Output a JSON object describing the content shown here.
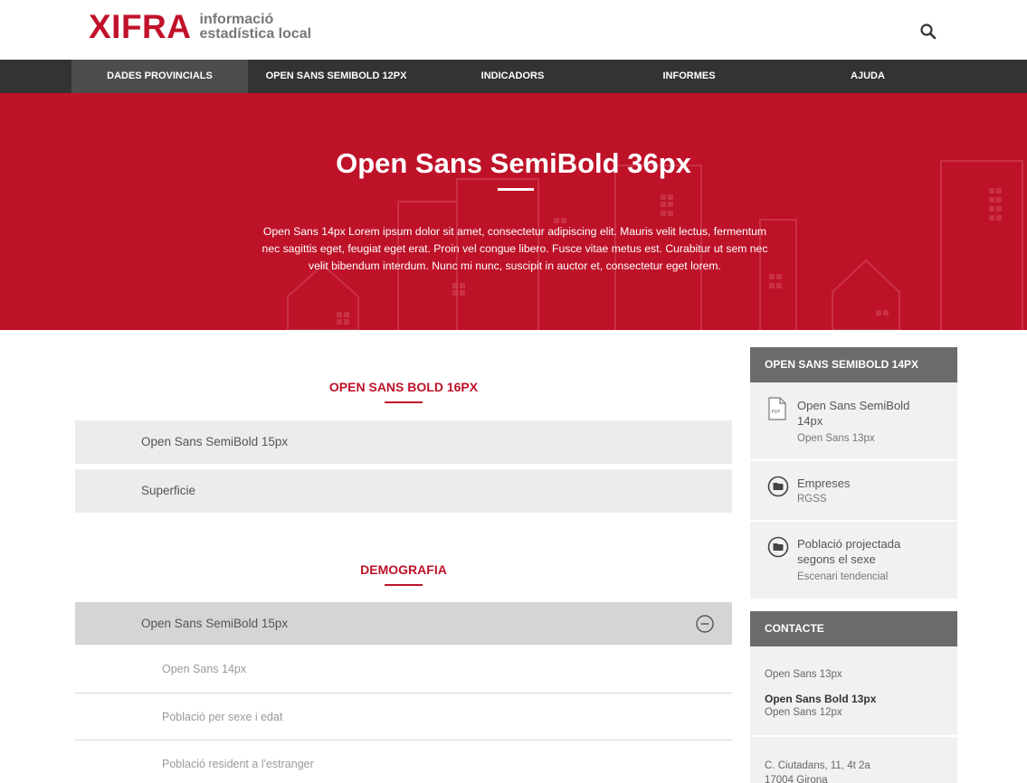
{
  "header": {
    "logo_mark": "XIFRA",
    "logo_line1": "informació",
    "logo_line2": "estadística local"
  },
  "nav": {
    "items": [
      {
        "label": "DADES PROVINCIALS"
      },
      {
        "label": "OPEN SANS SEMIBOLD 12PX"
      },
      {
        "label": "INDICADORS"
      },
      {
        "label": "INFORMES"
      },
      {
        "label": "AJUDA"
      }
    ]
  },
  "hero": {
    "title": "Open Sans SemiBold 36px",
    "line1": "Open Sans 14px Lorem ipsum dolor sit amet, consectetur adipiscing elit. Mauris velit lectus, fermentum",
    "line2": "nec sagittis eget, feugiat eget erat. Proin vel congue libero. Fusce vitae metus est. Curabitur ut sem nec",
    "line3": "velit bibendum interdum. Nunc mi nunc, suscipit in auctor et, consectetur eget lorem."
  },
  "main": {
    "section1": {
      "title": "OPEN SANS BOLD 16PX",
      "items": [
        {
          "label": "Open Sans SemiBold 15px"
        },
        {
          "label": "Superficie"
        }
      ]
    },
    "section2": {
      "title": "DEMOGRAFIA",
      "open_item": {
        "label": "Open Sans SemiBold 15px"
      },
      "sub_items": [
        {
          "label": "Open Sans 14px"
        },
        {
          "label": "Població per sexe i edat"
        },
        {
          "label": "Població resident a l'estranger"
        }
      ]
    }
  },
  "sidebar": {
    "docs_title": "OPEN SANS SEMIBOLD 14PX",
    "docs": [
      {
        "icon": "pdf-icon",
        "title_line1": "Open Sans SemiBold",
        "title_line2": "14px",
        "subtitle": "Open Sans 13px"
      },
      {
        "icon": "folder-icon",
        "title_line1": "Empreses",
        "subtitle": "RGSS"
      },
      {
        "icon": "folder-icon",
        "title_line1": "Població projectada",
        "title_line2": "segons el sexe",
        "subtitle": "Escenari tendencial"
      }
    ],
    "contact_title": "CONTACTE",
    "contact": {
      "line1": "Open Sans 13px",
      "bold": "Open Sans Bold 13px",
      "line2": "Open Sans 12px",
      "address1": "C. Ciutadans, 11, 4t 2a",
      "address2": "17004 Girona"
    }
  },
  "colors": {
    "brand": "#be1229",
    "nav_bg": "#333333",
    "sidebar_head": "#6b6b6b"
  }
}
